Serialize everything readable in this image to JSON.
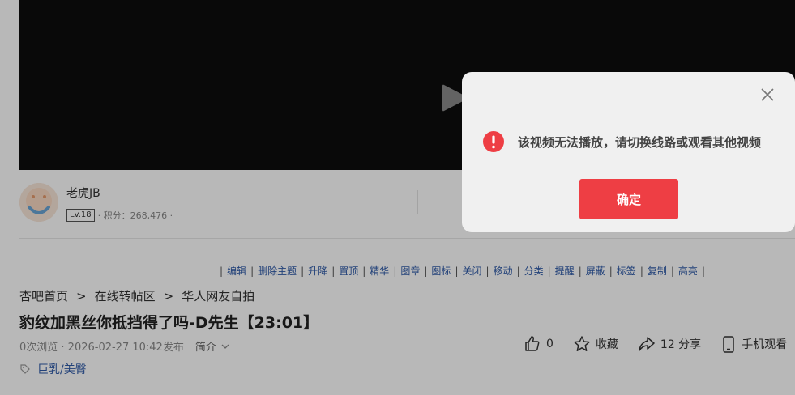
{
  "author": {
    "name": "老虎JB",
    "level": "Lv.18",
    "points_label": "· 积分：268,476 ·"
  },
  "admin_tools": [
    "编辑",
    "删除主题",
    "升降",
    "置顶",
    "精华",
    "图章",
    "图标",
    "关闭",
    "移动",
    "分类",
    "提醒",
    "屏蔽",
    "标签",
    "复制",
    "高亮"
  ],
  "breadcrumb": {
    "items": [
      "杏吧首页",
      "在线转帖区",
      "华人网友自拍"
    ],
    "separator": ">"
  },
  "post": {
    "title": "豹纹加黑丝你抵挡得了吗-D先生【23:01】",
    "views": "0次浏览 · 2026-02-27 10:42发布",
    "intro_label": "简介",
    "tag": "巨乳/美臀"
  },
  "actions": {
    "like_count": "0",
    "favorite_label": "收藏",
    "share_label": "12 分享",
    "mobile_label": "手机观看"
  },
  "modal": {
    "message": "该视频无法播放，请切换线路或观看其他视频",
    "confirm_label": "确定"
  },
  "colors": {
    "accent": "#ee3e44",
    "link": "#2f5aa8",
    "player_bg": "#0d0d0d"
  }
}
